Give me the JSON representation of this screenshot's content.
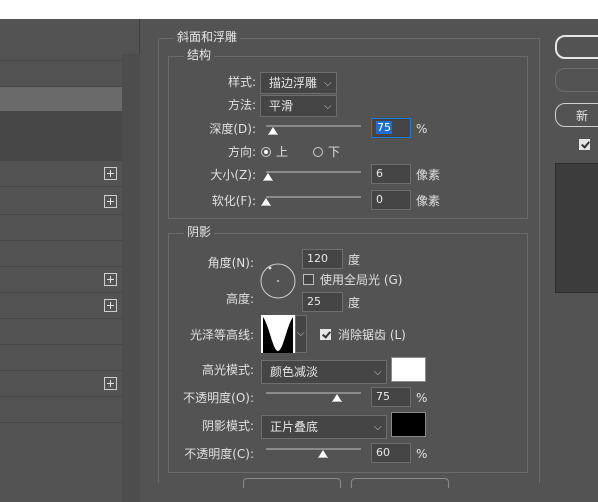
{
  "left_panel": {
    "rows": [
      {
        "plus": false
      },
      {
        "plus": false
      },
      {
        "plus": false,
        "state": "selected"
      },
      {
        "plus": false,
        "state": "dark"
      },
      {
        "plus": false,
        "state": "dark"
      },
      {
        "plus": true
      },
      {
        "plus": true
      },
      {
        "plus": false
      },
      {
        "plus": false
      },
      {
        "plus": true
      },
      {
        "plus": true
      },
      {
        "plus": false
      },
      {
        "plus": false
      },
      {
        "plus": true
      },
      {
        "plus": false
      }
    ]
  },
  "bevel": {
    "title": "斜面和浮雕",
    "structure": {
      "title": "结构",
      "style_label": "样式:",
      "style_value": "描边浮雕",
      "technique_label": "方法:",
      "technique_value": "平滑",
      "depth_label": "深度(D):",
      "depth_value": "75",
      "depth_unit": "%",
      "depth_level": 75,
      "direction_label": "方向:",
      "direction_up": "上",
      "direction_down": "下",
      "size_label": "大小(Z):",
      "size_value": "6",
      "size_unit": "像素",
      "size_level": 6,
      "soften_label": "软化(F):",
      "soften_value": "0",
      "soften_unit": "像素",
      "soften_level": 0
    },
    "shading": {
      "title": "阴影",
      "angle_label": "角度(N):",
      "angle_value": "120",
      "angle_unit": "度",
      "global_light_label": "使用全局光 (G)",
      "altitude_label": "高度:",
      "altitude_value": "25",
      "altitude_unit": "度",
      "gloss_label": "光泽等高线:",
      "antialias_label": "消除锯齿 (L)",
      "highlight_label": "高光模式:",
      "highlight_value": "颜色减淡",
      "highlight_color": "#ffffff",
      "highlight_opacity_label": "不透明度(O):",
      "highlight_opacity_value": "75",
      "highlight_opacity_unit": "%",
      "highlight_opacity_level": 75,
      "shadow_label": "阴影模式:",
      "shadow_value": "正片叠底",
      "shadow_color": "#000000",
      "shadow_opacity_label": "不透明度(C):",
      "shadow_opacity_value": "60",
      "shadow_opacity_unit": "%",
      "shadow_opacity_level": 60
    }
  },
  "right": {
    "new_style_label": "新"
  }
}
